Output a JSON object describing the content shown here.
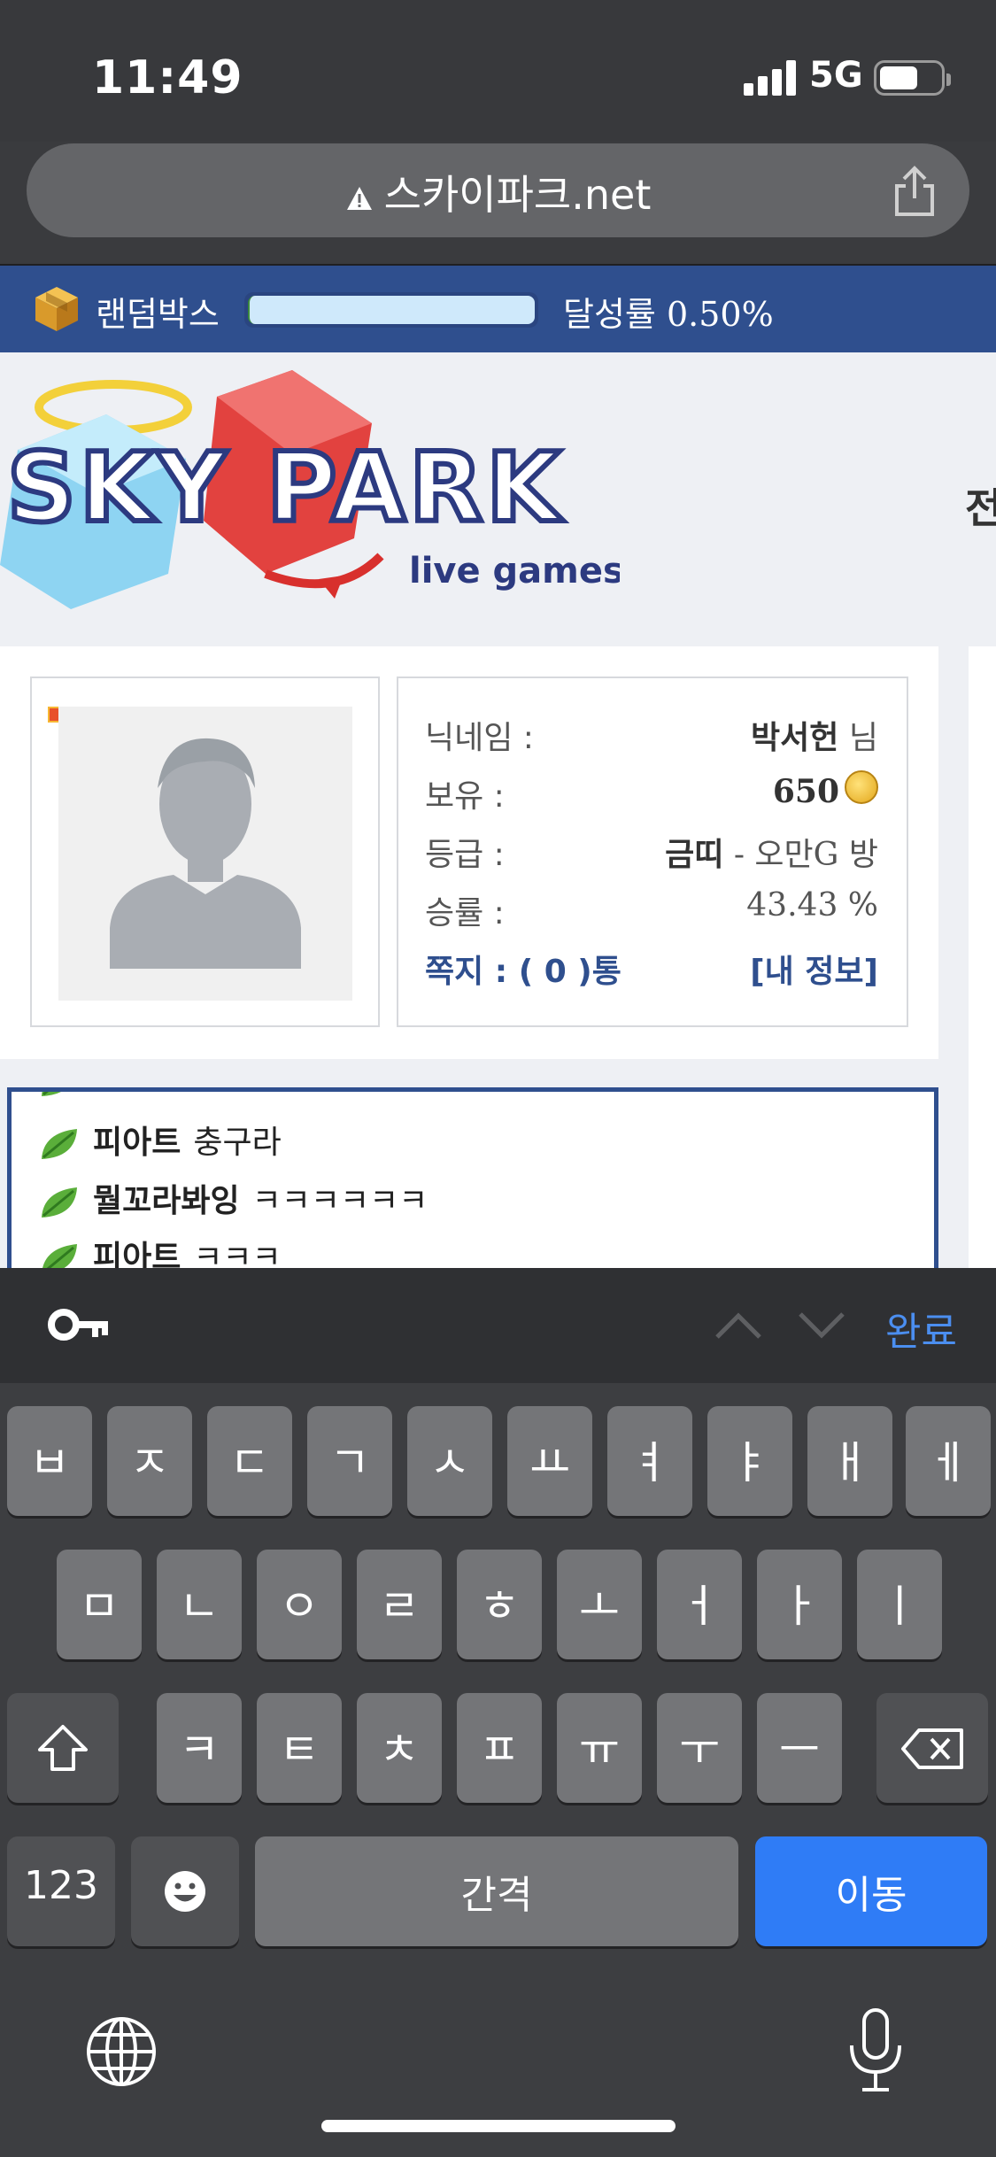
{
  "status": {
    "time": "11:49",
    "network": "5G"
  },
  "browser": {
    "url": "스카이파크.net"
  },
  "random_box": {
    "label": "랜덤박스",
    "progress_text": "달성률 0.50%",
    "progress": 0.005
  },
  "logo": {
    "main": "SKY PARK",
    "sub": "live games",
    "side_text": "전"
  },
  "profile": {
    "nickname_label": "닉네임 :",
    "nickname_value": "박서헌",
    "nickname_suffix": " 님",
    "holding_label": "보유 :",
    "holding_value": "650",
    "grade_label": "등급 :",
    "grade_value": "금띠",
    "grade_suffix": " - 오만G 방",
    "winrate_label": "승률 :",
    "winrate_value": "43.43 %",
    "message_link": "쪽지 : ( 0 )통",
    "myinfo_link": "[내 정보]"
  },
  "chat": [
    {
      "nick": "",
      "text": ""
    },
    {
      "nick": "피아트",
      "text": "충구라"
    },
    {
      "nick": "뭘꼬라봐잉",
      "text": "ㅋㅋㅋㅋㅋㅋ"
    },
    {
      "nick": "피아트",
      "text": "ㅋㅋㅋ"
    }
  ],
  "keyboard_toolbar": {
    "done": "완료"
  },
  "keyboard": {
    "row1": [
      "ㅂ",
      "ㅈ",
      "ㄷ",
      "ㄱ",
      "ㅅ",
      "ㅛ",
      "ㅕ",
      "ㅑ",
      "ㅐ",
      "ㅔ"
    ],
    "row2": [
      "ㅁ",
      "ㄴ",
      "ㅇ",
      "ㄹ",
      "ㅎ",
      "ㅗ",
      "ㅓ",
      "ㅏ",
      "ㅣ"
    ],
    "row3": [
      "ㅋ",
      "ㅌ",
      "ㅊ",
      "ㅍ",
      "ㅠ",
      "ㅜ",
      "ㅡ"
    ],
    "numbers": "123",
    "space": "간격",
    "go": "이동"
  }
}
